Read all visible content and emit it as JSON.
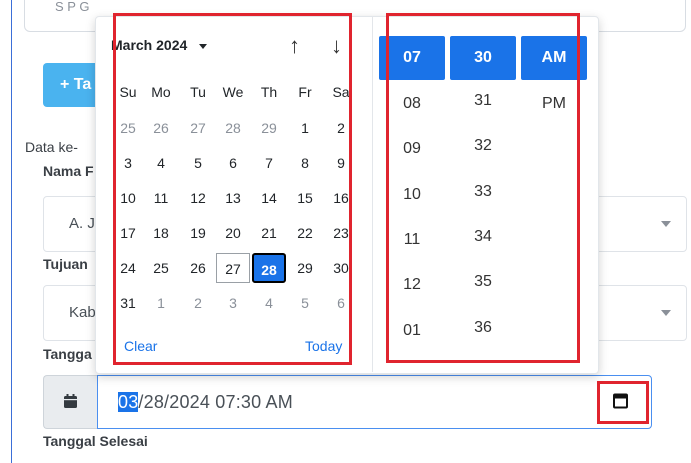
{
  "form": {
    "top_value": "S P G",
    "add_button_label": "+ Ta",
    "data_heading": "Data ke-",
    "nama_label": "Nama F",
    "nama_value": "A. J",
    "tujuan_label": "Tujuan",
    "tujuan_value": "Kab",
    "tanggal_label": "Tangga",
    "date_value_selected": "03",
    "date_value_rest": "/28/2024 07:30 AM",
    "tanggal_selesai_label": "Tanggal Selesai"
  },
  "calendar": {
    "month_label": "March 2024",
    "weekdays": [
      "Su",
      "Mo",
      "Tu",
      "We",
      "Th",
      "Fr",
      "Sa"
    ],
    "weeks": [
      [
        {
          "d": "25",
          "m": 1
        },
        {
          "d": "26",
          "m": 1
        },
        {
          "d": "27",
          "m": 1
        },
        {
          "d": "28",
          "m": 1
        },
        {
          "d": "29",
          "m": 1
        },
        {
          "d": "1",
          "m": 0
        },
        {
          "d": "2",
          "m": 0
        }
      ],
      [
        {
          "d": "3",
          "m": 0
        },
        {
          "d": "4",
          "m": 0
        },
        {
          "d": "5",
          "m": 0
        },
        {
          "d": "6",
          "m": 0
        },
        {
          "d": "7",
          "m": 0
        },
        {
          "d": "8",
          "m": 0
        },
        {
          "d": "9",
          "m": 0
        }
      ],
      [
        {
          "d": "10",
          "m": 0
        },
        {
          "d": "11",
          "m": 0
        },
        {
          "d": "12",
          "m": 0
        },
        {
          "d": "13",
          "m": 0
        },
        {
          "d": "14",
          "m": 0
        },
        {
          "d": "15",
          "m": 0
        },
        {
          "d": "16",
          "m": 0
        }
      ],
      [
        {
          "d": "17",
          "m": 0
        },
        {
          "d": "18",
          "m": 0
        },
        {
          "d": "19",
          "m": 0
        },
        {
          "d": "20",
          "m": 0
        },
        {
          "d": "21",
          "m": 0
        },
        {
          "d": "22",
          "m": 0
        },
        {
          "d": "23",
          "m": 0
        }
      ],
      [
        {
          "d": "24",
          "m": 0
        },
        {
          "d": "25",
          "m": 0
        },
        {
          "d": "26",
          "m": 0
        },
        {
          "d": "27",
          "m": 0,
          "today": 1
        },
        {
          "d": "28",
          "m": 0,
          "sel": 1
        },
        {
          "d": "29",
          "m": 0
        },
        {
          "d": "30",
          "m": 0
        }
      ],
      [
        {
          "d": "31",
          "m": 0
        },
        {
          "d": "1",
          "m": 1
        },
        {
          "d": "2",
          "m": 1
        },
        {
          "d": "3",
          "m": 1
        },
        {
          "d": "4",
          "m": 1
        },
        {
          "d": "5",
          "m": 1
        },
        {
          "d": "6",
          "m": 1
        }
      ]
    ],
    "clear_label": "Clear",
    "today_label": "Today"
  },
  "time": {
    "hour_selected": "07",
    "minute_selected": "30",
    "period_selected": "AM",
    "hours": [
      "08",
      "09",
      "10",
      "11",
      "12",
      "01"
    ],
    "minutes": [
      "31",
      "32",
      "33",
      "34",
      "35",
      "36"
    ],
    "periods": [
      "PM"
    ]
  },
  "colors": {
    "accent": "#1a73e8",
    "highlight_red": "#e0242e"
  }
}
